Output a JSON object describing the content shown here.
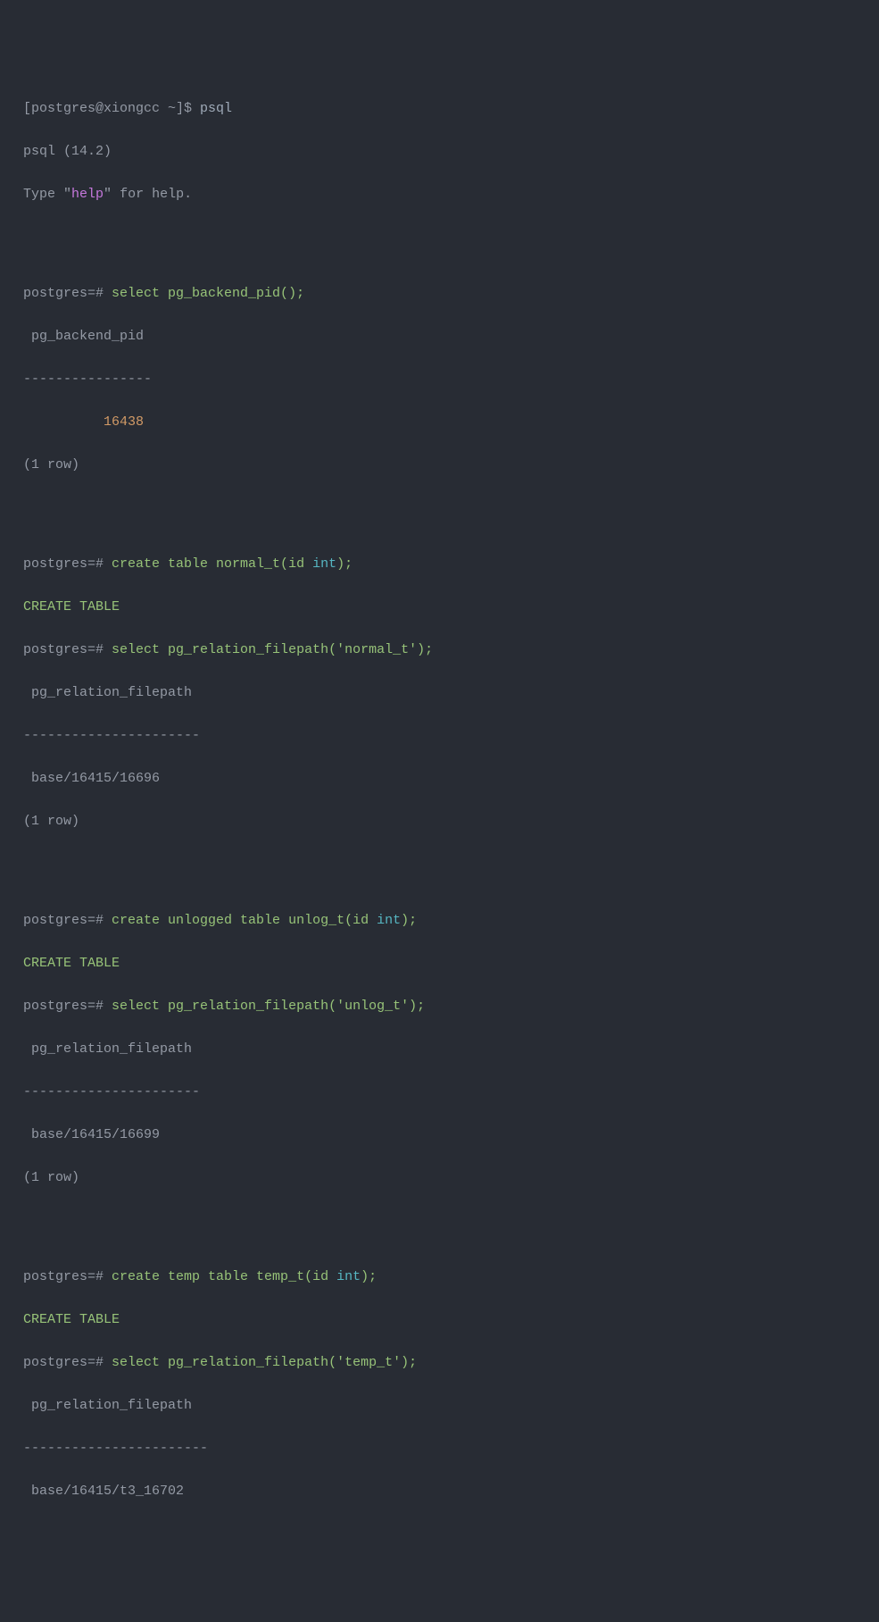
{
  "shell": {
    "prompt": "[postgres@xiongcc ~]$ ",
    "command": "psql"
  },
  "banner": {
    "line1": "psql (14.2)",
    "line2_prefix": "Type ",
    "line2_quote1": "\"",
    "line2_keyword": "help",
    "line2_quote2": "\"",
    "line2_suffix": " for help."
  },
  "block1": {
    "prompt": "postgres=# ",
    "cmd": "select pg_backend_pid();",
    "col": " pg_backend_pid ",
    "sep": "----------------",
    "val_prefix": "          ",
    "val": "16438",
    "rows": "(1 row)"
  },
  "block2": {
    "prompt1": "postgres=# ",
    "cmd1_a": "create table normal_t(",
    "cmd1_id": "id",
    "cmd1_b": " ",
    "cmd1_int": "int",
    "cmd1_c": ");",
    "resp1": "CREATE TABLE",
    "prompt2": "postgres=# ",
    "cmd2_a": "select pg_relation_filepath(",
    "cmd2_str": "'normal_t'",
    "cmd2_b": ");",
    "col": " pg_relation_filepath ",
    "sep": "----------------------",
    "val": " base/16415/16696",
    "rows": "(1 row)"
  },
  "block3": {
    "prompt1": "postgres=# ",
    "cmd1_a": "create unlogged table unlog_t(",
    "cmd1_id": "id",
    "cmd1_b": " ",
    "cmd1_int": "int",
    "cmd1_c": ");",
    "resp1": "CREATE TABLE",
    "prompt2": "postgres=# ",
    "cmd2_a": "select pg_relation_filepath(",
    "cmd2_str": "'unlog_t'",
    "cmd2_b": ");",
    "col": " pg_relation_filepath ",
    "sep": "----------------------",
    "val": " base/16415/16699",
    "rows": "(1 row)"
  },
  "block4": {
    "prompt1": "postgres=# ",
    "cmd1_a": "create temp table temp_t(",
    "cmd1_id": "id",
    "cmd1_b": " ",
    "cmd1_int": "int",
    "cmd1_c": ");",
    "resp1": "CREATE TABLE",
    "prompt2": "postgres=# ",
    "cmd2_a": "select pg_relation_filepath(",
    "cmd2_str": "'temp_t'",
    "cmd2_b": ");",
    "col": " pg_relation_filepath ",
    "sep": "-----------------------",
    "val": " base/16415/t3_16702"
  }
}
